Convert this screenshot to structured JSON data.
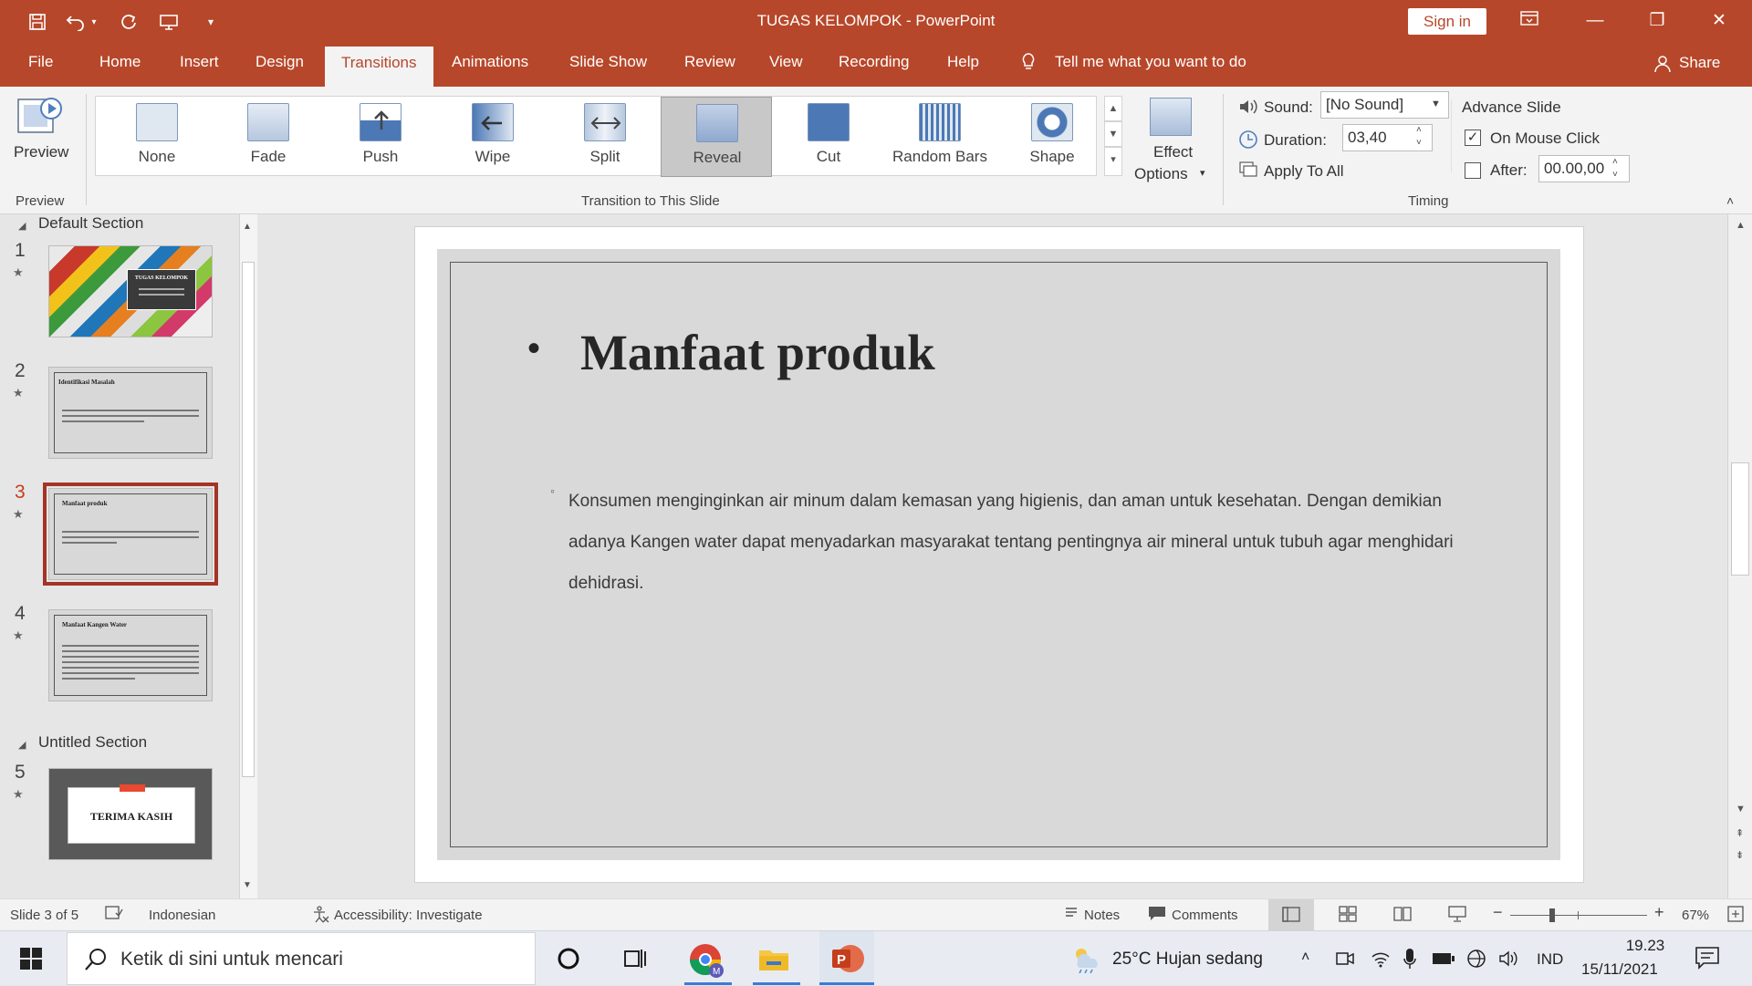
{
  "window": {
    "title": "TUGAS KELOMPOK  -  PowerPoint",
    "sign_in": "Sign in",
    "colors": {
      "accent": "#b7472a",
      "selected_thumb_border": "#a33426"
    }
  },
  "menu": {
    "tabs": [
      "File",
      "Home",
      "Insert",
      "Design",
      "Transitions",
      "Animations",
      "Slide Show",
      "Review",
      "View",
      "Recording",
      "Help"
    ],
    "active_tab": "Transitions",
    "tell_me": "Tell me what you want to do",
    "share": "Share"
  },
  "ribbon": {
    "preview_label": "Preview",
    "preview_group": "Preview",
    "transitions": [
      "None",
      "Fade",
      "Push",
      "Wipe",
      "Split",
      "Reveal",
      "Cut",
      "Random Bars",
      "Shape"
    ],
    "selected_transition": "Reveal",
    "effect_options": [
      "Effect",
      "Options"
    ],
    "group_transition": "Transition to This Slide",
    "sound_label": "Sound:",
    "sound_value": "[No Sound]",
    "duration_label": "Duration:",
    "duration_value": "03,40",
    "apply_all": "Apply To All",
    "advance_slide": "Advance Slide",
    "on_mouse_click": "On Mouse Click",
    "on_mouse_click_checked": true,
    "after_label": "After:",
    "after_value": "00.00,00",
    "after_checked": false,
    "group_timing": "Timing"
  },
  "thumbnails": {
    "section1": "Default Section",
    "section2": "Untitled Section",
    "slides": [
      {
        "num": "1",
        "title": "TUGAS KELOMPOK"
      },
      {
        "num": "2",
        "title": "Identifikasi Masalah"
      },
      {
        "num": "3",
        "title": "Manfaat produk"
      },
      {
        "num": "4",
        "title": "Manfaat Kangen Water"
      },
      {
        "num": "5",
        "title": "TERIMA KASIH"
      }
    ],
    "current": 3
  },
  "slide": {
    "title": "Manfaat produk",
    "body": "Konsumen menginginkan air minum dalam kemasan yang higienis, dan aman untuk kesehatan.  Dengan demikian adanya Kangen water dapat menyadarkan masyarakat tentang pentingnya air mineral untuk tubuh agar menghidari dehidrasi."
  },
  "status": {
    "slide_info": "Slide 3 of 5",
    "language": "Indonesian",
    "accessibility": "Accessibility: Investigate",
    "notes": "Notes",
    "comments": "Comments",
    "zoom": "67%"
  },
  "taskbar": {
    "search_placeholder": "Ketik di sini untuk mencari",
    "weather": "25°C  Hujan sedang",
    "lang": "IND",
    "time": "19.23",
    "date": "15/11/2021"
  }
}
